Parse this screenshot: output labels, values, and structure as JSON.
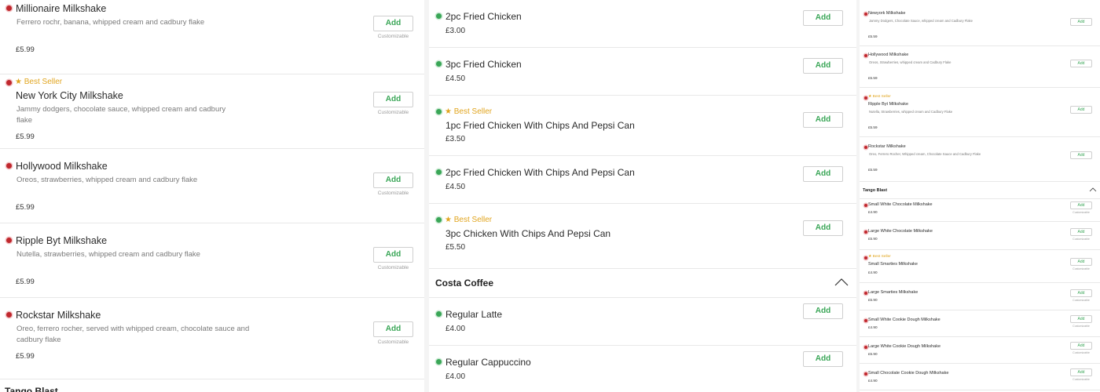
{
  "col1": {
    "items": [
      {
        "name": "Millionaire Milkshake",
        "desc": "Ferrero rochr, banana, whipped cream and cadbury flake",
        "price": "£5.99",
        "best": "",
        "add": "Add",
        "custom": "Customizable"
      },
      {
        "name": "New York City Milkshake",
        "desc": "Jammy dodgers, chocolate sauce, whipped cream and cadbury flake",
        "price": "£5.99",
        "best": "Best Seller",
        "add": "Add",
        "custom": "Customizable"
      },
      {
        "name": "Hollywood Milkshake",
        "desc": "Oreos, strawberries, whipped cream and cadbury flake",
        "price": "£5.99",
        "best": "",
        "add": "Add",
        "custom": "Customizable"
      },
      {
        "name": "Ripple Byt Milkshake",
        "desc": "Nutella, strawberries, whipped cream and cadbury flake",
        "price": "£5.99",
        "best": "",
        "add": "Add",
        "custom": "Customizable"
      },
      {
        "name": "Rockstar Milkshake",
        "desc": "Oreo, ferrero rocher, served with whipped cream, chocolate sauce and cadbury flake",
        "price": "£5.99",
        "best": "",
        "add": "Add",
        "custom": "Customizable"
      }
    ],
    "next_section_partial": "Tango Blast"
  },
  "col2": {
    "items_a": [
      {
        "name": "2pc Fried Chicken",
        "price": "£3.00",
        "best": "",
        "add": "Add"
      },
      {
        "name": "3pc Fried Chicken",
        "price": "£4.50",
        "best": "",
        "add": "Add"
      },
      {
        "name": "1pc Fried Chicken With Chips And Pepsi Can",
        "price": "£3.50",
        "best": "Best Seller",
        "add": "Add"
      },
      {
        "name": "2pc Fried Chicken With Chips And Pepsi Can",
        "price": "£4.50",
        "best": "",
        "add": "Add"
      },
      {
        "name": "3pc Chicken With Chips And Pepsi Can",
        "price": "£5.50",
        "best": "Best Seller",
        "add": "Add"
      }
    ],
    "section_title": "Costa Coffee",
    "items_b": [
      {
        "name": "Regular Latte",
        "price": "£4.00",
        "best": "",
        "add": "Add"
      },
      {
        "name": "Regular Cappuccino",
        "price": "£4.00",
        "best": "",
        "add": "Add"
      }
    ]
  },
  "col3": {
    "items_a": [
      {
        "name": "Newyork Milkshake",
        "desc": "Jammy Dodgers, Chocolate Sauce, whipped cream and Cadbury Flake",
        "price": "£5.59",
        "best": "",
        "add": "Add"
      },
      {
        "name": "Hollywood Milkshake",
        "desc": "Oreos, Strawberries, whipped cream and Cadbury Flake",
        "price": "£5.59",
        "best": "",
        "add": "Add"
      },
      {
        "name": "Ripple Byt Milkshake",
        "desc": "Nutella, Strawberries, whipped cream and Cadbury Flake",
        "price": "£5.59",
        "best": "Best Seller",
        "add": "Add"
      },
      {
        "name": "Rockstar Milkshake",
        "desc": "Oreo, Ferrero Rocher, Whipped cream, Chocolate Sauce and Cadbury Flake",
        "price": "£5.59",
        "best": "",
        "add": "Add"
      }
    ],
    "section_title": "Tango Blast",
    "items_b": [
      {
        "name": "Small White Chocolate Milkshake",
        "price": "£4.90",
        "best": "",
        "add": "Add",
        "custom": "Customizable"
      },
      {
        "name": "Large White Chocolate Milkshake",
        "price": "£5.90",
        "best": "",
        "add": "Add",
        "custom": "Customizable"
      },
      {
        "name": "Small Smarties Milkshake",
        "price": "£4.90",
        "best": "Best Seller",
        "add": "Add",
        "custom": "Customizable"
      },
      {
        "name": "Large Smarties Milkshake",
        "price": "£5.90",
        "best": "",
        "add": "Add",
        "custom": "Customizable"
      },
      {
        "name": "Small White Cookie Dough Milkshake",
        "price": "£4.90",
        "best": "",
        "add": "Add",
        "custom": "Customizable"
      },
      {
        "name": "Large White Cookie Dough Milkshake",
        "price": "£5.90",
        "best": "",
        "add": "Add",
        "custom": "Customizable"
      },
      {
        "name": "Small Chocolate Cookie Dough Milkshake",
        "price": "£4.90",
        "best": "",
        "add": "Add",
        "custom": "Customizable"
      }
    ]
  },
  "colors": {
    "add_green": "#3aa657",
    "nonveg_red": "#c0272d",
    "best_seller_gold": "#e1a51f"
  },
  "icons": {
    "best_seller": "star-icon",
    "nonveg": "nonveg-dot-icon",
    "veg": "veg-dot-icon",
    "collapse": "chevron-up-icon"
  }
}
